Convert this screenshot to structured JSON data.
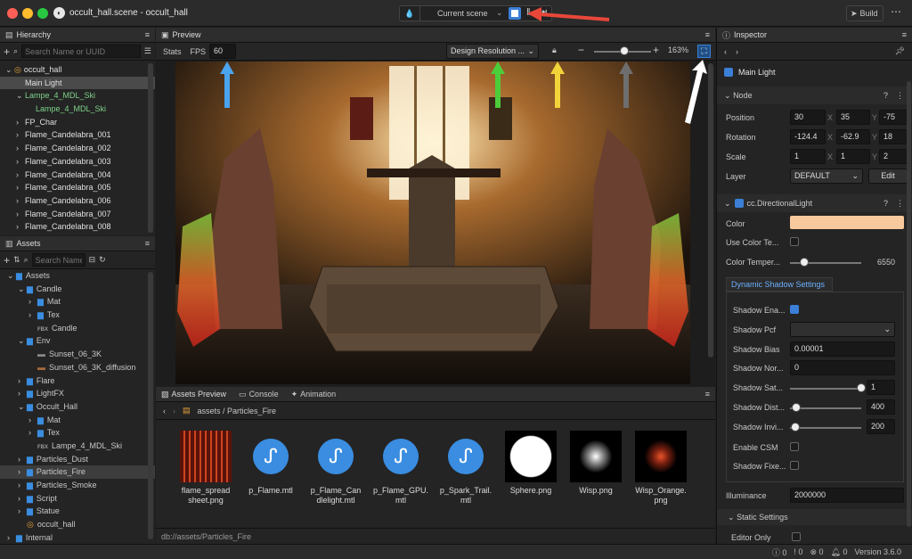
{
  "window": {
    "title": "occult_hall.scene - occult_hall",
    "scene_select": "Current scene",
    "build_label": "Build"
  },
  "hierarchy": {
    "title": "Hierarchy",
    "search_placeholder": "Search Name or UUID",
    "items": [
      {
        "label": "occult_hall",
        "depth": 0,
        "icon": "scene",
        "selected": false,
        "color": "#e0e0e0"
      },
      {
        "label": "Main Light",
        "depth": 1,
        "icon": "none",
        "selected": true,
        "color": "#e0e0e0"
      },
      {
        "label": "Lampe_4_MDL_Ski",
        "depth": 1,
        "icon": "arrow-open",
        "selected": false,
        "color": "#7fd28a"
      },
      {
        "label": "Lampe_4_MDL_Ski",
        "depth": 2,
        "icon": "none",
        "selected": false,
        "color": "#7fd28a"
      },
      {
        "label": "FP_Char",
        "depth": 1,
        "icon": "arrow",
        "selected": false,
        "color": "#e0e0e0"
      },
      {
        "label": "Flame_Candelabra_001",
        "depth": 1,
        "icon": "arrow",
        "selected": false,
        "color": "#e0e0e0"
      },
      {
        "label": "Flame_Candelabra_002",
        "depth": 1,
        "icon": "arrow",
        "selected": false,
        "color": "#e0e0e0"
      },
      {
        "label": "Flame_Candelabra_003",
        "depth": 1,
        "icon": "arrow",
        "selected": false,
        "color": "#e0e0e0"
      },
      {
        "label": "Flame_Candelabra_004",
        "depth": 1,
        "icon": "arrow",
        "selected": false,
        "color": "#e0e0e0"
      },
      {
        "label": "Flame_Candelabra_005",
        "depth": 1,
        "icon": "arrow",
        "selected": false,
        "color": "#e0e0e0"
      },
      {
        "label": "Flame_Candelabra_006",
        "depth": 1,
        "icon": "arrow",
        "selected": false,
        "color": "#e0e0e0"
      },
      {
        "label": "Flame_Candelabra_007",
        "depth": 1,
        "icon": "arrow",
        "selected": false,
        "color": "#e0e0e0"
      },
      {
        "label": "Flame_Candelabra_008",
        "depth": 1,
        "icon": "arrow",
        "selected": false,
        "color": "#e0e0e0"
      }
    ]
  },
  "assets": {
    "title": "Assets",
    "search_placeholder": "Search Name o",
    "items": [
      {
        "label": "Assets",
        "depth": 0,
        "icon": "folder",
        "open": true
      },
      {
        "label": "Candle",
        "depth": 1,
        "icon": "folder",
        "open": true
      },
      {
        "label": "Mat",
        "depth": 2,
        "icon": "folder",
        "open": false
      },
      {
        "label": "Tex",
        "depth": 2,
        "icon": "folder",
        "open": false
      },
      {
        "label": "Candle",
        "depth": 2,
        "icon": "fbx",
        "open": false
      },
      {
        "label": "Env",
        "depth": 1,
        "icon": "folder",
        "open": true
      },
      {
        "label": "Sunset_06_3K",
        "depth": 2,
        "icon": "image",
        "open": false
      },
      {
        "label": "Sunset_06_3K_diffusion",
        "depth": 2,
        "icon": "image2",
        "open": false
      },
      {
        "label": "Flare",
        "depth": 1,
        "icon": "folder",
        "open": false
      },
      {
        "label": "LightFX",
        "depth": 1,
        "icon": "folder",
        "open": false
      },
      {
        "label": "Occult_Hall",
        "depth": 1,
        "icon": "folder",
        "open": true
      },
      {
        "label": "Mat",
        "depth": 2,
        "icon": "folder",
        "open": false
      },
      {
        "label": "Tex",
        "depth": 2,
        "icon": "folder",
        "open": false
      },
      {
        "label": "Lampe_4_MDL_Ski",
        "depth": 2,
        "icon": "fbx",
        "open": false
      },
      {
        "label": "Particles_Dust",
        "depth": 1,
        "icon": "folder",
        "open": false
      },
      {
        "label": "Particles_Fire",
        "depth": 1,
        "icon": "folder",
        "open": false,
        "selected": true
      },
      {
        "label": "Particles_Smoke",
        "depth": 1,
        "icon": "folder",
        "open": false
      },
      {
        "label": "Script",
        "depth": 1,
        "icon": "folder",
        "open": false
      },
      {
        "label": "Statue",
        "depth": 1,
        "icon": "folder",
        "open": false
      },
      {
        "label": "occult_hall",
        "depth": 1,
        "icon": "scene",
        "open": false
      },
      {
        "label": "Internal",
        "depth": 0,
        "icon": "folder",
        "open": false
      }
    ]
  },
  "preview": {
    "title": "Preview",
    "stats_label": "Stats",
    "fps_label": "FPS",
    "fps_value": "60",
    "resolution": "Design Resolution ...",
    "zoom": "163%"
  },
  "bottom": {
    "tabs": [
      "Assets Preview",
      "Console",
      "Animation"
    ],
    "breadcrumb": [
      "assets",
      "Particles_Fire"
    ],
    "status_path": "db://assets/Particles_Fire",
    "items": [
      {
        "label": "flame_spread\nsheet.png",
        "kind": "sheet"
      },
      {
        "label": "p_Flame.mtl",
        "kind": "mtl"
      },
      {
        "label": "p_Flame_Can\ndlelight.mtl",
        "kind": "mtl"
      },
      {
        "label": "p_Flame_GPU.\nmtl",
        "kind": "mtl"
      },
      {
        "label": "p_Spark_Trail.\nmtl",
        "kind": "mtl"
      },
      {
        "label": "Sphere.png",
        "kind": "sphere"
      },
      {
        "label": "Wisp.png",
        "kind": "wisp"
      },
      {
        "label": "Wisp_Orange.\npng",
        "kind": "wisp-orange"
      }
    ]
  },
  "inspector": {
    "title": "Inspector",
    "node_name": "Main Light",
    "node_section": "Node",
    "position": {
      "label": "Position",
      "x": "30",
      "y": "35",
      "z": "-75"
    },
    "rotation": {
      "label": "Rotation",
      "x": "-124.4",
      "y": "-62.9",
      "z": "18"
    },
    "scale": {
      "label": "Scale",
      "x": "1",
      "y": "1",
      "z": "2"
    },
    "layer": {
      "label": "Layer",
      "value": "DEFAULT",
      "edit": "Edit"
    },
    "component": "cc.DirectionalLight",
    "color_label": "Color",
    "color_value": "#f8c99d",
    "use_color_temp": "Use Color Te...",
    "color_temp": {
      "label": "Color Temper...",
      "value": "6550",
      "fraction": 0.2
    },
    "shadow_tab": "Dynamic Shadow Settings",
    "shadow_enabled": "Shadow Ena...",
    "shadow_pcf": "Shadow Pcf",
    "shadow_bias": {
      "label": "Shadow Bias",
      "value": "0.00001"
    },
    "shadow_normal": {
      "label": "Shadow Nor...",
      "value": "0"
    },
    "shadow_sat": {
      "label": "Shadow Sat...",
      "value": "1",
      "fraction": 1.0
    },
    "shadow_dist": {
      "label": "Shadow Dist...",
      "value": "400",
      "fraction": 0.04
    },
    "shadow_invis": {
      "label": "Shadow Invi...",
      "value": "200",
      "fraction": 0.02
    },
    "enable_csm": "Enable CSM",
    "shadow_fixed": "Shadow Fixe...",
    "illuminance": {
      "label": "Illuminance",
      "value": "2000000"
    },
    "static_settings": "Static Settings",
    "editor_only": "Editor Only"
  },
  "statusbar": {
    "info": "0",
    "warn": "0",
    "error": "0",
    "notify": "0",
    "version": "Version 3.6.0"
  },
  "colors": {
    "accent": "#3b7fd6",
    "prefab": "#7fd28a",
    "bg": "#1e1e1e",
    "panel": "#242424",
    "arrow_red": "#e8473a",
    "arrow_blue": "#4aa3ee",
    "arrow_green": "#4ccd3a",
    "arrow_yellow": "#f2d43a",
    "arrow_gray": "#6e6e6e",
    "arrow_white": "#ffffff"
  }
}
